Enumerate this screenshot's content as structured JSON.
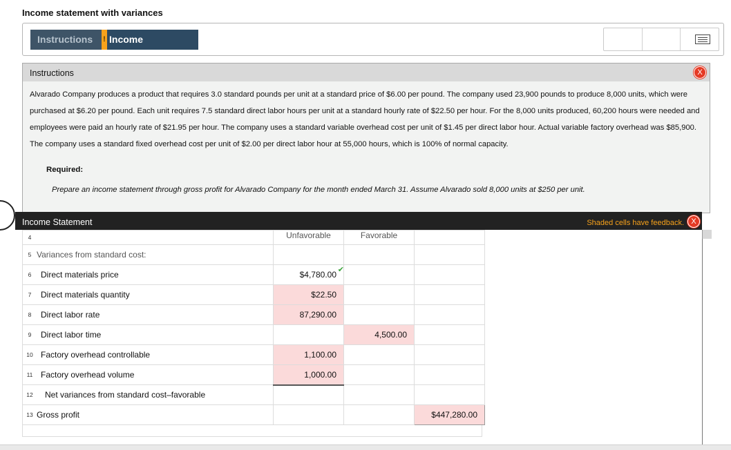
{
  "page": {
    "title": "Income statement with variances"
  },
  "tabs": [
    {
      "label": "Instructions",
      "active": false
    },
    {
      "label": "Income Statement",
      "active": true,
      "warning": "!"
    }
  ],
  "instructions": {
    "header": "Instructions",
    "body": "Alvarado Company produces a product that requires 3.0 standard pounds per unit at a standard price of $6.00 per pound. The company used 23,900 pounds to produce 8,000 units, which were purchased at $6.20 per pound. Each unit requires 7.5 standard direct labor hours per unit at a standard hourly rate of $22.50 per hour. For the 8,000 units produced, 60,200 hours were needed and employees were paid an hourly rate of $21.95 per hour. The company uses a standard variable overhead cost per unit of $1.45 per direct labor hour. Actual variable factory overhead was $85,900. The company uses a standard fixed overhead cost per unit of $2.00 per direct labor hour at 55,000 hours, which is 100% of normal capacity.",
    "required_label": "Required:",
    "required_text": "Prepare an income statement through gross profit for Alvarado Company for the month ended March 31. Assume Alvarado sold 8,000 units at $250 per unit.",
    "close": "X"
  },
  "income_statement": {
    "header": "Income Statement",
    "feedback_note": "Shaded cells have feedback.",
    "close": "X",
    "columns": {
      "unfavorable": "Unfavorable",
      "favorable": "Favorable"
    },
    "rows": [
      {
        "num": "4",
        "label": "",
        "unfav": "",
        "fav": "",
        "last": ""
      },
      {
        "num": "5",
        "label": "Variances from standard cost:",
        "unfav": "",
        "fav": "",
        "last": ""
      },
      {
        "num": "6",
        "label": "Direct materials price",
        "unfav": "$4,780.00",
        "fav": "",
        "last": ""
      },
      {
        "num": "7",
        "label": "Direct materials quantity",
        "unfav": "$22.50",
        "fav": "",
        "last": ""
      },
      {
        "num": "8",
        "label": "Direct labor rate",
        "unfav": "87,290.00",
        "fav": "",
        "last": ""
      },
      {
        "num": "9",
        "label": "Direct labor time",
        "unfav": "",
        "fav": "4,500.00",
        "last": ""
      },
      {
        "num": "10",
        "label": "Factory overhead controllable",
        "unfav": "1,100.00",
        "fav": "",
        "last": ""
      },
      {
        "num": "11",
        "label": "Factory overhead volume",
        "unfav": "1,000.00",
        "fav": "",
        "last": ""
      },
      {
        "num": "12",
        "label": "Net variances from standard cost–favorable",
        "unfav": "",
        "fav": "",
        "last": ""
      },
      {
        "num": "13",
        "label": "Gross profit",
        "unfav": "",
        "fav": "",
        "last": "$447,280.00"
      }
    ]
  },
  "colors": {
    "tab_active": "#2d4a63",
    "warning": "#f7a21b",
    "shaded_cell": "#fbdada",
    "close_red": "#e53a25",
    "check_green": "#3aa33a"
  }
}
